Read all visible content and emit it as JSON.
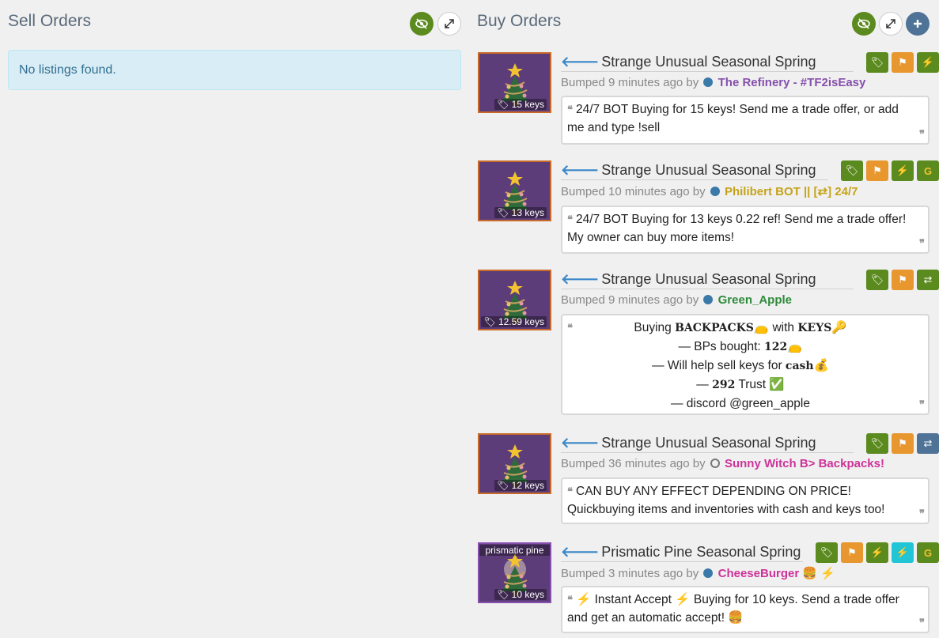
{
  "sell": {
    "title": "Sell Orders",
    "empty_text": "No listings found."
  },
  "buy": {
    "title": "Buy Orders"
  },
  "listings": [
    {
      "name": "Strange Unusual Seasonal Spring",
      "price": "15 keys",
      "bumped": "Bumped 9 minutes ago by",
      "user": "The Refinery - #TF2isEasy",
      "user_color": "#8650ac",
      "message": "24/7 BOT Buying for 15 keys! Send me a trade offer, or add me and type !sell"
    },
    {
      "name": "Strange Unusual Seasonal Spring",
      "price": "13 keys",
      "bumped": "Bumped 10 minutes ago by",
      "user": "Philibert BOT || [⇄] 24/7",
      "user_color": "#c5a31b",
      "message": "24/7 BOT Buying for 13 keys 0.22 ref! Send me a trade offer! My owner can buy more items!"
    },
    {
      "name": "Strange Unusual Seasonal Spring",
      "price": "12.59 keys",
      "bumped": "Bumped 9 minutes ago by",
      "user": "Green_Apple",
      "user_color": "#2e8b3a",
      "message_lines": [
        {
          "a": "Buying ",
          "b": "BACKPACKS",
          "c": "👝 with ",
          "d": "KEYS",
          "e": "🔑"
        },
        {
          "a": "— BPs bought: ",
          "b": "122",
          "c": "👝",
          "d": "",
          "e": ""
        },
        {
          "a": "— Will help sell keys for ",
          "b": "cash",
          "c": "💰",
          "d": "",
          "e": ""
        },
        {
          "a": "— ",
          "b": "292",
          "c": " Trust ✅",
          "d": "",
          "e": ""
        },
        {
          "a": "— discord @green_apple",
          "b": "",
          "c": "",
          "d": "",
          "e": ""
        }
      ]
    },
    {
      "name": "Strange Unusual Seasonal Spring",
      "price": "12 keys",
      "bumped": "Bumped 36 minutes ago by",
      "user": "Sunny Witch B> Backpacks!",
      "user_color": "#cc3399",
      "message": "CAN BUY ANY EFFECT DEPENDING ON PRICE! Quickbuying items and inventories with cash and keys too!"
    },
    {
      "name": "Prismatic Pine Seasonal Spring",
      "thumb_label": "prismatic pine",
      "price": "10 keys",
      "bumped": "Bumped 3 minutes ago by",
      "user": "CheeseBurger",
      "user_suffix": "🍔 ⚡",
      "user_color": "#cc3399",
      "message_pre": "⚡ Instant Accept ⚡",
      "message": " Buying for 10 keys. Send a trade offer and get an automatic accept! 🍔"
    }
  ],
  "icons": {
    "eye": "eye-slash-icon",
    "expand": "expand-icon",
    "plus": "plus-icon",
    "tag": "tag-icon",
    "flag": "flag-icon",
    "bolt": "bolt-icon",
    "exchange": "exchange-icon",
    "gladiator": "g-icon"
  }
}
